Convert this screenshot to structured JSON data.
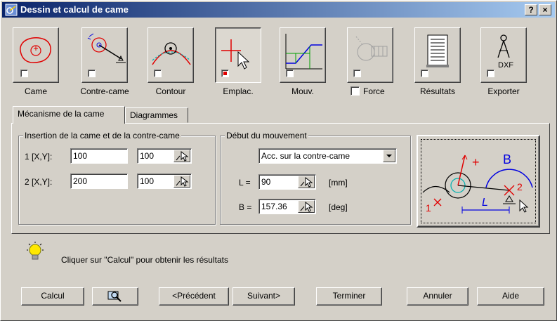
{
  "window": {
    "title": "Dessin et calcul de came",
    "help_glyph": "?",
    "close_glyph": "×"
  },
  "toolbar": {
    "items": [
      {
        "label": "Came",
        "icon": "cam-icon",
        "checked": false
      },
      {
        "label": "Contre-came",
        "icon": "counter-cam-icon",
        "checked": false
      },
      {
        "label": "Contour",
        "icon": "contour-icon",
        "checked": false
      },
      {
        "label": "Emplac.",
        "icon": "placement-icon",
        "checked": true
      },
      {
        "label": "Mouv.",
        "icon": "movement-icon",
        "checked": false
      },
      {
        "label": "Force",
        "icon": "force-icon",
        "checked": false
      },
      {
        "label": "Résultats",
        "icon": "results-icon",
        "checked": false
      },
      {
        "label": "Exporter",
        "icon": "export-dxf-icon",
        "checked": false,
        "icon_text": "DXF"
      }
    ]
  },
  "tabs": [
    {
      "label": "Mécanisme de la came",
      "active": true
    },
    {
      "label": "Diagrammes",
      "active": false
    }
  ],
  "insertion": {
    "legend": "Insertion de la came et de la contre-came",
    "rows": [
      {
        "label": "1 [X,Y]:",
        "x": "100",
        "y": "100"
      },
      {
        "label": "2 [X,Y]:",
        "x": "200",
        "y": "100"
      }
    ]
  },
  "movement": {
    "legend": "Début du mouvement",
    "mode_selected": "Acc. sur la contre-came",
    "L": {
      "label": "L =",
      "value": "90",
      "unit": "[mm]"
    },
    "B": {
      "label": "B =",
      "value": "157.36",
      "unit": "[deg]"
    }
  },
  "preview": {
    "label_B": "B",
    "label_L": "L",
    "label_1": "1",
    "label_2": "2",
    "label_plus": "+"
  },
  "hint": {
    "text": "Cliquer sur \"Calcul\" pour obtenir les résultats"
  },
  "buttons": {
    "calcul": "Calcul",
    "previous": "<Précédent",
    "next": "Suivant>",
    "finish": "Terminer",
    "cancel": "Annuler",
    "help": "Aide"
  },
  "colors": {
    "title_start": "#0a246a",
    "title_end": "#a6caf0",
    "drawing_red": "#e00000",
    "drawing_blue": "#0000e0",
    "drawing_cyan": "#00b0b0"
  }
}
